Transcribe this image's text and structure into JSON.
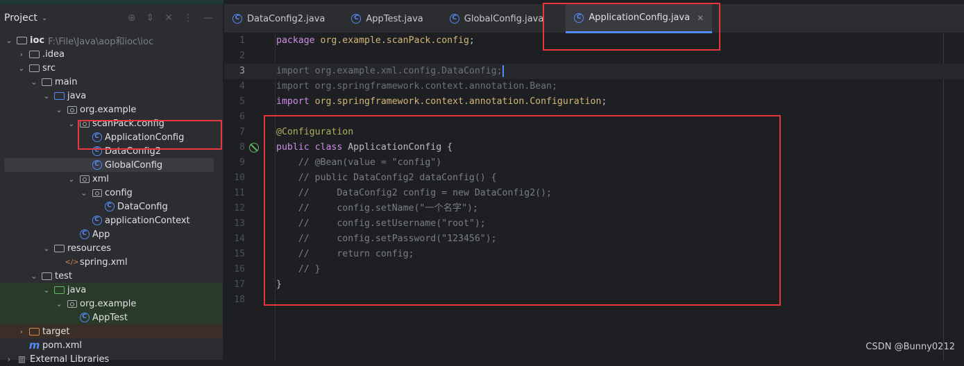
{
  "sidebar": {
    "title": "Project",
    "tools": [
      "locate-icon",
      "expand-collapse-icon",
      "close-icon",
      "more-icon",
      "minimize-icon"
    ],
    "tree": [
      {
        "label": "ioc",
        "path": "F:\\File\\Java\\aop和ioc\\ioc",
        "depth": 0,
        "arrow": "down",
        "icon": "module",
        "bold": true
      },
      {
        "label": ".idea",
        "depth": 1,
        "arrow": "right",
        "icon": "folder"
      },
      {
        "label": "src",
        "depth": 1,
        "arrow": "down",
        "icon": "folder"
      },
      {
        "label": "main",
        "depth": 2,
        "arrow": "down",
        "icon": "folder"
      },
      {
        "label": "java",
        "depth": 3,
        "arrow": "down",
        "icon": "folder-blue"
      },
      {
        "label": "org.example",
        "depth": 4,
        "arrow": "down",
        "icon": "package"
      },
      {
        "label": "scanPack.config",
        "depth": 5,
        "arrow": "down",
        "icon": "package"
      },
      {
        "label": "ApplicationConfig",
        "depth": 6,
        "icon": "class"
      },
      {
        "label": "DataConfig2",
        "depth": 6,
        "icon": "class"
      },
      {
        "label": "GlobalConfig",
        "depth": 6,
        "icon": "class",
        "selected": true
      },
      {
        "label": "xml",
        "depth": 5,
        "arrow": "down",
        "icon": "package"
      },
      {
        "label": "config",
        "depth": 6,
        "arrow": "down",
        "icon": "package"
      },
      {
        "label": "DataConfig",
        "depth": 7,
        "icon": "class"
      },
      {
        "label": "applicationContext",
        "depth": 6,
        "icon": "class"
      },
      {
        "label": "App",
        "depth": 5,
        "icon": "class"
      },
      {
        "label": "resources",
        "depth": 3,
        "arrow": "down",
        "icon": "folder"
      },
      {
        "label": "spring.xml",
        "depth": 4,
        "icon": "xml"
      },
      {
        "label": "test",
        "depth": 2,
        "arrow": "down",
        "icon": "folder"
      },
      {
        "label": "java",
        "depth": 3,
        "arrow": "down",
        "icon": "folder-green",
        "bg": "test"
      },
      {
        "label": "org.example",
        "depth": 4,
        "arrow": "down",
        "icon": "package",
        "bg": "test"
      },
      {
        "label": "AppTest",
        "depth": 5,
        "icon": "class",
        "bg": "test"
      },
      {
        "label": "target",
        "depth": 1,
        "arrow": "right",
        "icon": "folder-orange",
        "bg": "excl"
      },
      {
        "label": "pom.xml",
        "depth": 1,
        "icon": "maven"
      },
      {
        "label": "External Libraries",
        "depth": 0,
        "arrow": "right",
        "icon": "library"
      }
    ]
  },
  "tabs": [
    {
      "label": "DataConfig2.java"
    },
    {
      "label": "AppTest.java"
    },
    {
      "label": "GlobalConfig.java"
    },
    {
      "label": "ApplicationConfig.java",
      "active": true
    }
  ],
  "editor": {
    "current_line": 3,
    "lines": [
      [
        [
          "kw",
          "package "
        ],
        [
          "pk",
          "org.example.scanPack.config"
        ],
        [
          "pl",
          ";"
        ]
      ],
      [],
      [
        [
          "dim",
          "import org.example.xml.config.DataConfig;"
        ]
      ],
      [
        [
          "dim",
          "import org.springframework.context.annotation.Bean;"
        ]
      ],
      [
        [
          "kw",
          "import "
        ],
        [
          "pk",
          "org.springframework.context.annotation.Configuration"
        ],
        [
          "pl",
          ";"
        ]
      ],
      [],
      [
        [
          "ann",
          "@Configuration"
        ]
      ],
      [
        [
          "kw",
          "public class "
        ],
        [
          "pl",
          "ApplicationConfig {"
        ]
      ],
      [
        [
          "cm",
          "    // @Bean(value = \"config\")"
        ]
      ],
      [
        [
          "cm",
          "    // public DataConfig2 dataConfig() {"
        ]
      ],
      [
        [
          "cm",
          "    //     DataConfig2 config = new DataConfig2();"
        ]
      ],
      [
        [
          "cm",
          "    //     config.setName(\"一个名字\");"
        ]
      ],
      [
        [
          "cm",
          "    //     config.setUsername(\"root\");"
        ]
      ],
      [
        [
          "cm",
          "    //     config.setPassword(\"123456\");"
        ]
      ],
      [
        [
          "cm",
          "    //     return config;"
        ]
      ],
      [
        [
          "cm",
          "    // }"
        ]
      ],
      [
        [
          "pl",
          "}"
        ]
      ],
      []
    ]
  },
  "watermark": "CSDN @Bunny0212",
  "colors": {
    "accent": "#548af7",
    "highlight_box": "#e8383d"
  }
}
